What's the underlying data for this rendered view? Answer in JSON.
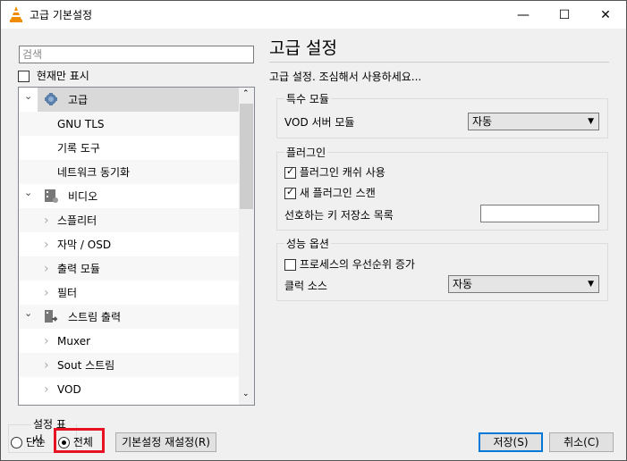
{
  "window": {
    "title": "고급 기본설정",
    "minimize": "—",
    "maximize": "☐",
    "close": "✕"
  },
  "sidebar": {
    "search_placeholder": "검색",
    "current_only_label": "현재만 표시",
    "tree": [
      {
        "label": "고급",
        "level": 0,
        "expanded": true,
        "selected": true,
        "icon": "gear-icon"
      },
      {
        "label": "GNU TLS",
        "level": 1
      },
      {
        "label": "기록 도구",
        "level": 1
      },
      {
        "label": "네트워크 동기화",
        "level": 1
      },
      {
        "label": "비디오",
        "level": 0,
        "expanded": true,
        "icon": "video-icon"
      },
      {
        "label": "스플리터",
        "level": 1,
        "collapsed": true
      },
      {
        "label": "자막 / OSD",
        "level": 1,
        "collapsed": true
      },
      {
        "label": "출력 모듈",
        "level": 1,
        "collapsed": true
      },
      {
        "label": "필터",
        "level": 1,
        "collapsed": true
      },
      {
        "label": "스트림 출력",
        "level": 0,
        "expanded": true,
        "icon": "stream-output-icon"
      },
      {
        "label": "Muxer",
        "level": 1,
        "collapsed": true
      },
      {
        "label": "Sout 스트림",
        "level": 1,
        "collapsed": true
      },
      {
        "label": "VOD",
        "level": 1,
        "collapsed": true
      }
    ]
  },
  "main": {
    "title": "고급 설정",
    "subtitle": "고급 설정. 조심해서 사용하세요...",
    "special_modules": {
      "legend": "특수 모듈",
      "vod_label": "VOD 서버 모듈",
      "vod_value": "자동"
    },
    "plugins": {
      "legend": "플러그인",
      "cache_label": "플러그인 캐쉬 사용",
      "cache_checked": true,
      "scan_label": "새 플러그인 스캔",
      "scan_checked": true,
      "keystore_label": "선호하는 키 저장소 목록",
      "keystore_value": ""
    },
    "performance": {
      "legend": "성능 옵션",
      "priority_label": "프로세스의 우선순위 증가",
      "priority_checked": false,
      "clock_label": "클럭 소스",
      "clock_value": "자동"
    }
  },
  "footer": {
    "show_settings_legend": "설정 표시",
    "simple_label": "단순",
    "all_label": "전체",
    "selected": "all",
    "reset_label": "기본설정 재설정(R)",
    "save_label": "저장(S)",
    "cancel_label": "취소(C)"
  },
  "colors": {
    "highlight": "#e81123",
    "focus": "#0078d7"
  }
}
